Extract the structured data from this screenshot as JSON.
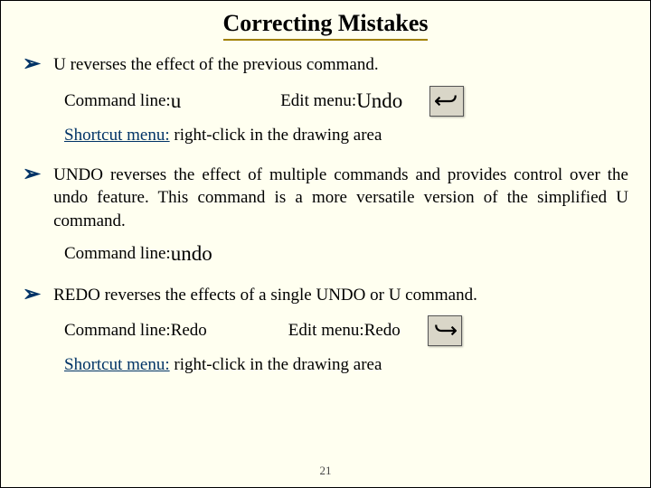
{
  "title": "Correcting Mistakes",
  "items": [
    {
      "lead": "U",
      "body": " reverses the effect of the previous command.",
      "cmdline_label": "Command line: ",
      "cmdline_value": "u",
      "editmenu_label": "Edit menu: ",
      "editmenu_value": "Undo",
      "shortcut_label": "Shortcut menu:",
      "shortcut_body": " right-click in the drawing area"
    },
    {
      "lead": "UNDO",
      "body": " reverses the effect of multiple commands and provides control over the undo feature. This command is a more versatile version of the simplified U command.",
      "cmdline_label": "Command line: ",
      "cmdline_value": "undo"
    },
    {
      "lead": "REDO",
      "body": " reverses the effects of a single UNDO or U command.",
      "cmdline_label": "Command line: ",
      "cmdline_value": "Redo",
      "editmenu_label": "Edit menu: ",
      "editmenu_value": "Redo",
      "shortcut_label": "Shortcut menu:",
      "shortcut_body": " right-click in the drawing area"
    }
  ],
  "page_number": "21"
}
